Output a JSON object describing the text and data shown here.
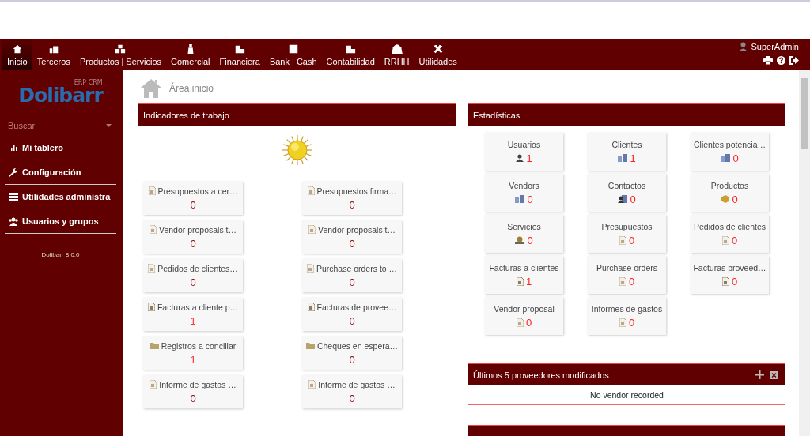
{
  "nav": {
    "items": [
      {
        "label": "Inicio",
        "selected": true
      },
      {
        "label": "Terceros",
        "selected": false
      },
      {
        "label": "Productos | Servicios",
        "selected": false
      },
      {
        "label": "Comercial",
        "selected": false
      },
      {
        "label": "Financiera",
        "selected": false
      },
      {
        "label": "Bank | Cash",
        "selected": false
      },
      {
        "label": "Contabilidad",
        "selected": false
      },
      {
        "label": "RRHH",
        "selected": false
      },
      {
        "label": "Utilidades",
        "selected": false
      }
    ],
    "user": "SuperAdmin"
  },
  "sidebar": {
    "logo": "Dolibarr",
    "logo_sub": "ERP CRM",
    "search": {
      "placeholder": "Buscar"
    },
    "items": [
      {
        "label": "Mi tablero",
        "kind": "chart"
      },
      {
        "label": "Configuración",
        "kind": "wrench"
      },
      {
        "label": "Utilidades administra",
        "kind": "list"
      },
      {
        "label": "Usuarios y grupos",
        "kind": "users"
      }
    ],
    "version": "Dolibarr 8.0.0"
  },
  "breadcrumb": "Área inicio",
  "indicators": {
    "title": "Indicadores de trabajo",
    "items": [
      {
        "label": "Presupuestos a cer…",
        "count": "0",
        "kind": "document",
        "color": "#990000"
      },
      {
        "label": "Presupuestos firma…",
        "count": "0",
        "kind": "document",
        "color": "#990000"
      },
      {
        "label": "Vendor proposals t…",
        "count": "0",
        "kind": "document",
        "color": "#990000"
      },
      {
        "label": "Vendor proposals t…",
        "count": "0",
        "kind": "document",
        "color": "#990000"
      },
      {
        "label": "Pedidos de clientes…",
        "count": "0",
        "kind": "document",
        "color": "#990000"
      },
      {
        "label": "Purchase orders to …",
        "count": "0",
        "kind": "document",
        "color": "#990000"
      },
      {
        "label": "Facturas a cliente p…",
        "count": "1",
        "kind": "invoice",
        "color": "#ff3333"
      },
      {
        "label": "Facturas de provee…",
        "count": "0",
        "kind": "invoice",
        "color": "#990000"
      },
      {
        "label": "Registros a conciliar",
        "count": "1",
        "kind": "folder",
        "color": "#ff3333"
      },
      {
        "label": "Cheques en espera…",
        "count": "0",
        "kind": "folder",
        "color": "#990000"
      },
      {
        "label": "Informe de gastos …",
        "count": "0",
        "kind": "document",
        "color": "#990000"
      },
      {
        "label": "Informe de gastos …",
        "count": "0",
        "kind": "document",
        "color": "#990000"
      }
    ]
  },
  "statistics": {
    "title": "Estadísticas",
    "items": [
      {
        "label": "Usuarios",
        "count": "1",
        "kind": "user"
      },
      {
        "label": "Clientes",
        "count": "1",
        "kind": "company"
      },
      {
        "label": "Clientes potencia…",
        "count": "0",
        "kind": "company"
      },
      {
        "label": "Vendors",
        "count": "0",
        "kind": "company"
      },
      {
        "label": "Contactos",
        "count": "0",
        "kind": "contact"
      },
      {
        "label": "Productos",
        "count": "0",
        "kind": "product"
      },
      {
        "label": "Servicios",
        "count": "0",
        "kind": "service"
      },
      {
        "label": "Presupuestos",
        "count": "0",
        "kind": "document"
      },
      {
        "label": "Pedidos de clientes",
        "count": "0",
        "kind": "document"
      },
      {
        "label": "Facturas a clientes",
        "count": "1",
        "kind": "invoice"
      },
      {
        "label": "Purchase orders",
        "count": "0",
        "kind": "document"
      },
      {
        "label": "Facturas proveed…",
        "count": "0",
        "kind": "invoice"
      },
      {
        "label": "Vendor proposal",
        "count": "0",
        "kind": "document"
      },
      {
        "label": "Informes de gastos",
        "count": "0",
        "kind": "document"
      }
    ]
  },
  "vendors": {
    "title": "Últimos 5 proveedores modificados",
    "empty": "No vendor recorded"
  }
}
